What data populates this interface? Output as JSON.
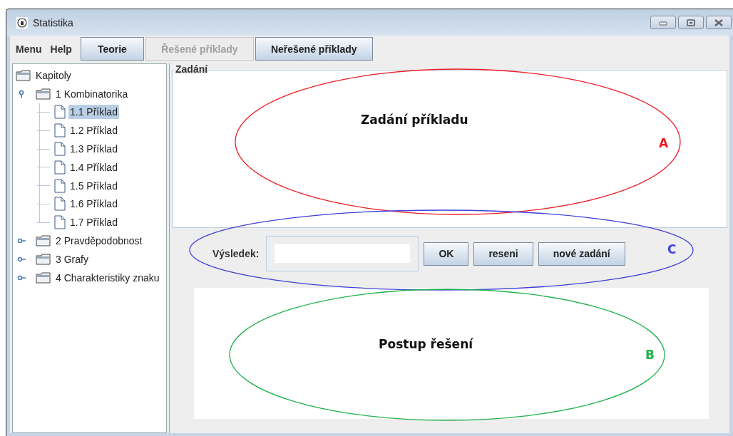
{
  "window": {
    "title": "Statistika"
  },
  "menu_bar": {
    "menus": [
      "Menu",
      "Help"
    ],
    "tabs": [
      {
        "label": "Teorie",
        "disabled": false
      },
      {
        "label": "Řešené příklady",
        "disabled": true
      },
      {
        "label": "Neřešené příklady",
        "disabled": false
      }
    ]
  },
  "tree": {
    "label": "Kapitoly",
    "kind": "folder",
    "selected": false,
    "children": [
      {
        "label": "1 Kombinatorika",
        "kind": "folder",
        "expanded": true,
        "selected": false,
        "children": [
          {
            "label": "1.1 Příklad",
            "kind": "document",
            "selected": true
          },
          {
            "label": "1.2 Příklad",
            "kind": "document",
            "selected": false
          },
          {
            "label": "1.3 Příklad",
            "kind": "document",
            "selected": false
          },
          {
            "label": "1.4 Příklad",
            "kind": "document",
            "selected": false
          },
          {
            "label": "1.5 Příklad",
            "kind": "document",
            "selected": false
          },
          {
            "label": "1.6 Příklad",
            "kind": "document",
            "selected": false
          },
          {
            "label": "1.7 Příklad",
            "kind": "document",
            "selected": false
          }
        ]
      },
      {
        "label": "2 Pravděpodobnost",
        "kind": "folder",
        "expanded": false,
        "selected": false
      },
      {
        "label": "3 Grafy",
        "kind": "folder",
        "expanded": false,
        "selected": false
      },
      {
        "label": "4 Charakteristiky znaku",
        "kind": "folder",
        "expanded": false,
        "selected": false
      }
    ]
  },
  "task_panel": {
    "title": "Zadání"
  },
  "result_row": {
    "label": "Výsledek:",
    "buttons": [
      "OK",
      "reseni",
      "nové zadání"
    ]
  },
  "annotations": [
    {
      "caption": "Zadání příkladu",
      "letter": "A",
      "color": "#ee1c24"
    },
    {
      "letter": "C",
      "color": "#3f3fd8"
    },
    {
      "caption": "Postup řešení",
      "letter": "B",
      "color": "#22b14c"
    }
  ]
}
